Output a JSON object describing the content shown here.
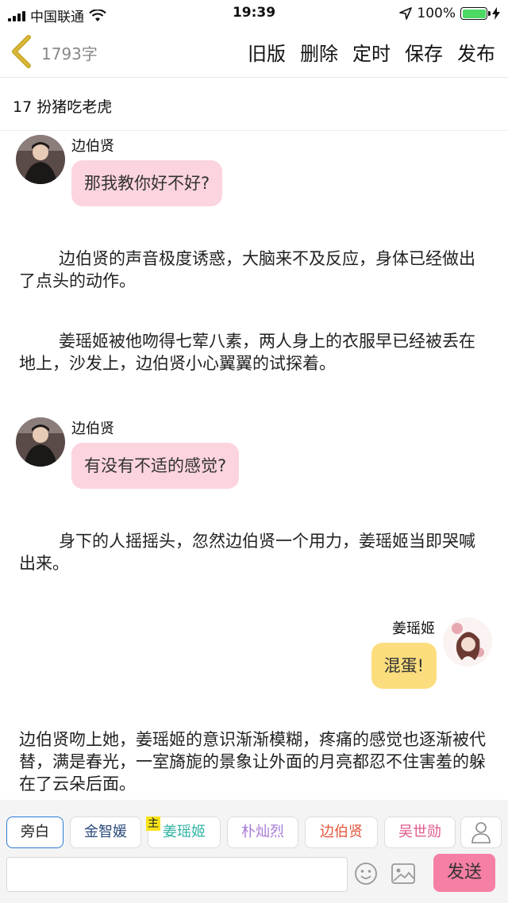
{
  "status_bar": {
    "carrier": "中国联通",
    "time": "19:39",
    "battery": "100%"
  },
  "nav": {
    "word_count": "1793字",
    "actions": [
      "旧版",
      "删除",
      "定时",
      "保存",
      "发布"
    ]
  },
  "chapter_title": "17 扮猪吃老虎",
  "content": {
    "messages": [
      {
        "speaker": "边伯贤",
        "text": "那我教你好不好?"
      },
      {
        "speaker": "边伯贤",
        "text": "有没有不适的感觉?"
      },
      {
        "speaker": "姜瑶姬",
        "text": "混蛋!"
      }
    ],
    "paragraphs": [
      "边伯贤的声音极度诱惑，大脑来不及反应，身体已经做出了点头的动作。",
      "姜瑶姬被他吻得七荤八素，两人身上的衣服早已经被丢在地上，沙发上，边伯贤小心翼翼的试探着。",
      "身下的人摇摇头，忽然边伯贤一个用力，姜瑶姬当即哭喊出来。",
      "边伯贤吻上她，姜瑶姬的意识渐渐模糊，疼痛的感觉也逐渐被代替，满是春光，一室旖旎的景象让外面的月亮都忍不住害羞的躲在了云朵后面。"
    ]
  },
  "characters": {
    "host_badge": "主",
    "chips": [
      {
        "label": "旁白",
        "color": "#222222"
      },
      {
        "label": "金智媛",
        "color": "#2a4a7a"
      },
      {
        "label": "姜瑶姬",
        "color": "#2fb3a3"
      },
      {
        "label": "朴灿烈",
        "color": "#a77bd6"
      },
      {
        "label": "边伯贤",
        "color": "#e2573c"
      },
      {
        "label": "吴世勋",
        "color": "#e05a8c"
      }
    ]
  },
  "input": {
    "placeholder": "",
    "send_label": "发送"
  },
  "colors": {
    "bubble_pink": "#fcd4de",
    "bubble_yellow": "#fbdd7e",
    "send_button": "#f67fa4",
    "active_chip_border": "#2e7bd6"
  }
}
